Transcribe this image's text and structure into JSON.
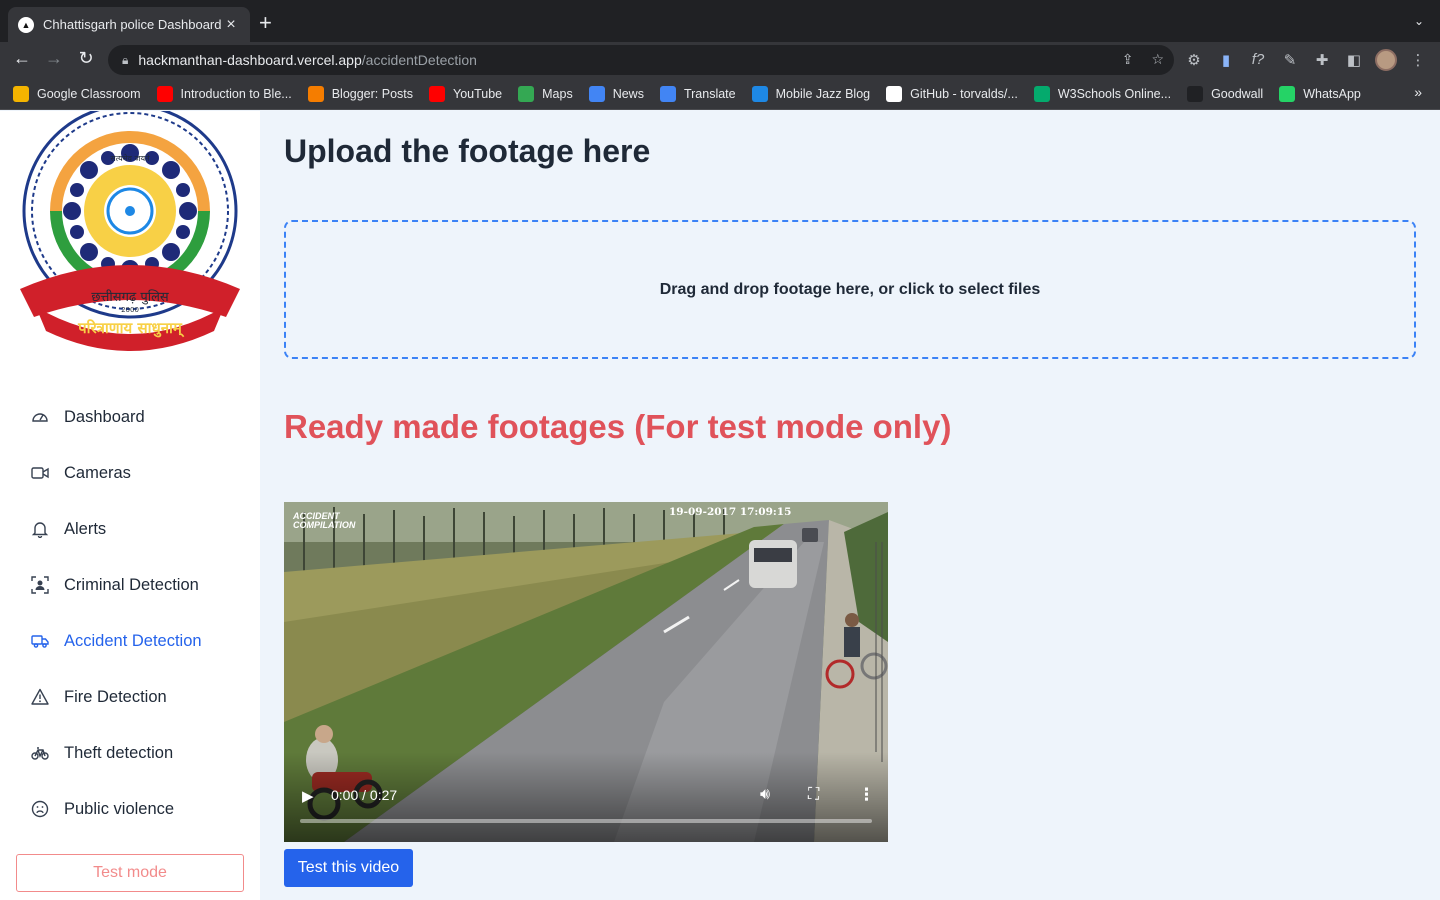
{
  "browser": {
    "tab_title": "Chhattisgarh police Dashboard",
    "url_host": "hackmanthan-dashboard.vercel.app",
    "url_path": "/accidentDetection",
    "bookmarks": [
      {
        "label": "Google Classroom",
        "color": "#f4b400"
      },
      {
        "label": "Introduction to Ble...",
        "color": "#ff0000"
      },
      {
        "label": "Blogger: Posts",
        "color": "#f57d00"
      },
      {
        "label": "YouTube",
        "color": "#ff0000"
      },
      {
        "label": "Maps",
        "color": "#34a853"
      },
      {
        "label": "News",
        "color": "#4285f4"
      },
      {
        "label": "Translate",
        "color": "#4285f4"
      },
      {
        "label": "Mobile Jazz Blog",
        "color": "#1e88e5"
      },
      {
        "label": "GitHub - torvalds/...",
        "color": "#ffffff"
      },
      {
        "label": "W3Schools Online...",
        "color": "#04aa6d"
      },
      {
        "label": "Goodwall",
        "color": "#202124"
      },
      {
        "label": "WhatsApp",
        "color": "#25d366"
      }
    ],
    "bookmarks_more": "»"
  },
  "sidebar": {
    "emblem_text": {
      "motto_top": "सत्यमेव जयते",
      "ribbon": "छत्तीसगढ़ पुलिस",
      "year": "2000",
      "banner": "परित्राणाय साधुनाम्"
    },
    "items": [
      {
        "label": "Dashboard",
        "icon": "gauge-icon",
        "active": false
      },
      {
        "label": "Cameras",
        "icon": "video-camera-icon",
        "active": false
      },
      {
        "label": "Alerts",
        "icon": "bell-icon",
        "active": false
      },
      {
        "label": "Criminal Detection",
        "icon": "face-scan-icon",
        "active": false
      },
      {
        "label": "Accident Detection",
        "icon": "truck-icon",
        "active": true
      },
      {
        "label": "Fire Detection",
        "icon": "warning-triangle-icon",
        "active": false
      },
      {
        "label": "Theft detection",
        "icon": "bicycle-icon",
        "active": false
      },
      {
        "label": "Public violence",
        "icon": "frown-icon",
        "active": false
      }
    ],
    "test_mode_label": "Test mode"
  },
  "main": {
    "upload_title": "Upload the footage here",
    "dropzone_text": "Drag and drop footage here, or click to select files",
    "ready_title": "Ready made footages (For test mode only)",
    "video": {
      "time": "0:00 / 0:27",
      "timestamp_overlay": "19-09-2017 17:09:15",
      "logo_line1": "ACCIDENT",
      "logo_line2": "COMPILATION",
      "progress": 0
    },
    "test_button_label": "Test this video"
  },
  "colors": {
    "accent": "#2563eb",
    "ready_title": "#e0525a",
    "test_mode": "#f28b8b",
    "background": "#eef4fb"
  }
}
